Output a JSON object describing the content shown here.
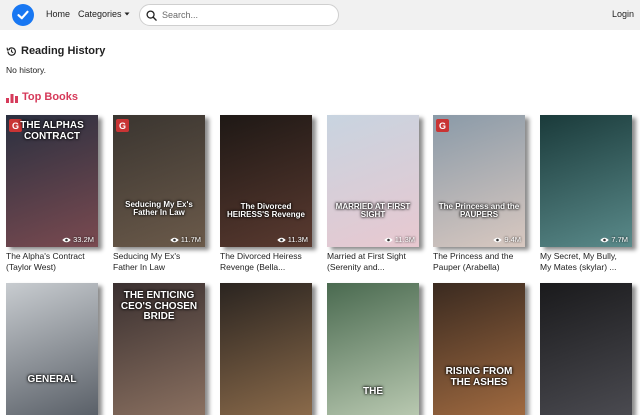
{
  "nav": {
    "home": "Home",
    "categories": "Categories",
    "search_placeholder": "Search...",
    "login": "Login"
  },
  "reading_history": {
    "title": "Reading History",
    "empty": "No history."
  },
  "top_books": {
    "title": "Top Books",
    "books": [
      {
        "cover_text": "THE ALPHAS CONTRACT",
        "views": "33.2M",
        "title_line1": "The Alpha's Contract",
        "title_line2": "(Taylor West)",
        "badge": "G",
        "colors": [
          "#2a3040",
          "#7a4a50"
        ]
      },
      {
        "cover_text": "Seducing My Ex's Father In Law",
        "views": "11.7M",
        "title_line1": "Seducing My Ex's",
        "title_line2": "Father In Law",
        "badge": "G",
        "colors": [
          "#3a3530",
          "#6b5a4a"
        ]
      },
      {
        "cover_text": "The Divorced HEIRESS'S Revenge",
        "views": "11.3M",
        "title_line1": "The Divorced Heiress",
        "title_line2": "Revenge (Bella...",
        "badge": "",
        "colors": [
          "#1e1815",
          "#5a3a30"
        ]
      },
      {
        "cover_text": "MARRIED AT FIRST SIGHT",
        "views": "11.3M",
        "title_line1": "Married at First Sight",
        "title_line2": "(Serenity and...",
        "badge": "",
        "colors": [
          "#c8d4e0",
          "#e8c8d0"
        ]
      },
      {
        "cover_text": "The Princess and the PAUPERS",
        "views": "9.4M",
        "title_line1": "The Princess and the",
        "title_line2": "Pauper (Arabella)",
        "badge": "G",
        "colors": [
          "#8a9aa8",
          "#d8c8c0"
        ]
      },
      {
        "cover_text": "",
        "views": "7.7M",
        "title_line1": "My Secret, My Bully,",
        "title_line2": "My Mates (skylar) ...",
        "badge": "",
        "colors": [
          "#1a3a3a",
          "#5a8a8a"
        ]
      },
      {
        "cover_text": "GENERAL",
        "views": "",
        "title_line1": "",
        "title_line2": "",
        "badge": "",
        "colors": [
          "#c8ccd0",
          "#5a6068"
        ]
      },
      {
        "cover_text": "THE ENTICING CEO'S CHOSEN BRIDE",
        "views": "",
        "title_line1": "",
        "title_line2": "",
        "badge": "",
        "colors": [
          "#3a3030",
          "#8a7060"
        ]
      },
      {
        "cover_text": "",
        "views": "",
        "title_line1": "",
        "title_line2": "",
        "badge": "",
        "colors": [
          "#2a2420",
          "#8a6a4a"
        ]
      },
      {
        "cover_text": "THE",
        "views": "",
        "title_line1": "",
        "title_line2": "",
        "badge": "",
        "colors": [
          "#4a6a50",
          "#b8c8b0"
        ]
      },
      {
        "cover_text": "RISING FROM THE ASHES",
        "views": "",
        "title_line1": "",
        "title_line2": "",
        "badge": "",
        "colors": [
          "#3a2a20",
          "#a06a40"
        ]
      },
      {
        "cover_text": "",
        "views": "",
        "title_line1": "",
        "title_line2": "",
        "badge": "",
        "colors": [
          "#1a1a1c",
          "#4a4a50"
        ]
      }
    ]
  }
}
